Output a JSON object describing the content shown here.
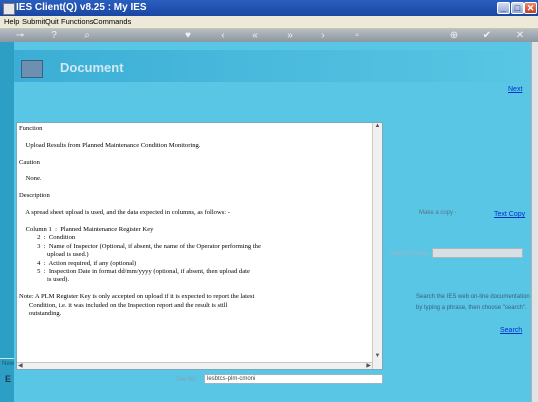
{
  "window": {
    "title": "IES Client(Q) v8.25 : My IES",
    "min_label": "_",
    "max_label": "□",
    "close_label": "✕"
  },
  "menu": [
    "Help",
    "Submit",
    "Quit",
    "Functions",
    "Commands"
  ],
  "header": {
    "title": "Document"
  },
  "nav": {
    "next": "Next"
  },
  "copy": {
    "label": "Make a copy -",
    "link": "Text Copy"
  },
  "search": {
    "label": "Search Phrase",
    "value": "",
    "hint_line1": "Search the IES web on-line documentation",
    "hint_line2": "by typing a phrase, then choose \"search\".",
    "link": "Search"
  },
  "doc_number": {
    "label": "Doc No.",
    "value": "lesbtcs-plm-cmoni"
  },
  "document": {
    "text": "Function\n\n    Upload Results from Planned Maintenance Condition Monitoring.\n\nCaution\n\n    None.\n\nDescription\n\n    A spread sheet upload is used, and the data expected in columns, as follows: -\n\n    Column 1  :  Planned Maintenance Register Key\n           2  :  Condition\n           3  :  Name of Inspector (Optional, if absent, the name of the Operator performing the\n                 upload is used.)\n           4  :  Action required, if any (optional)\n           5  :  Inspection Date in format dd/mm/yyyy (optional, if absent, then upload date\n                 is used).\n\nNote: A PLM Register Key is only accepted on upload if it is expected to report the latest\n      Condition, i.e. it was included on the Inspection report and the result is still\n      outstanding."
  },
  "sidebar": {
    "label": "New",
    "letter": "E"
  },
  "colors": {
    "titlebar": "#1a46a3",
    "background": "#58c6e4",
    "link": "#0033cc"
  },
  "toolbar_icons": [
    "key-icon",
    "help-icon",
    "search-icon",
    "heart-icon",
    "back-icon",
    "first-icon",
    "last-icon",
    "forward-icon",
    "up-icon",
    "stop-icon",
    "add-icon",
    "check-icon",
    "close-icon"
  ]
}
